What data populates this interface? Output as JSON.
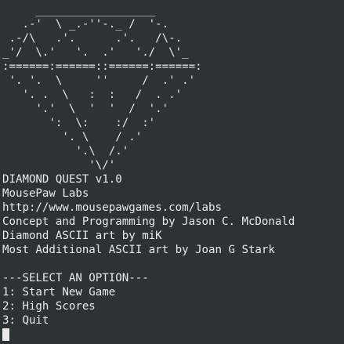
{
  "ascii_art": "     __________________\n   .-'  \\ _.-''-._ /  '-.\n .-/\\   .'.      .'.   /\\-.\n_'/  \\.'   '.  .'   './  \\'_\n:======:======::======:======:\n '. '.  \\     ''     /  .' .'\n   '. .  \\   :  :   /  . .'\n     '.'  \\  '  '  /  '.'\n       ':  \\:    :/  :'\n         '. \\    / .'\n           '.\\  /.'\n             '\\/'",
  "info_lines": [
    "DIAMOND QUEST v1.0",
    "MousePaw Labs",
    "http://www.mousepawgames.com/labs",
    "Concept and Programming by Jason C. McDonald",
    "Diamond ASCII art by miK",
    "Most Additional ASCII art by Joan G Stark"
  ],
  "menu": {
    "header": "---SELECT AN OPTION---",
    "options": [
      "1: Start New Game",
      "2: High Scores",
      "3: Quit"
    ]
  },
  "colors": {
    "background": "#2d3233",
    "foreground": "#eaeaea"
  }
}
